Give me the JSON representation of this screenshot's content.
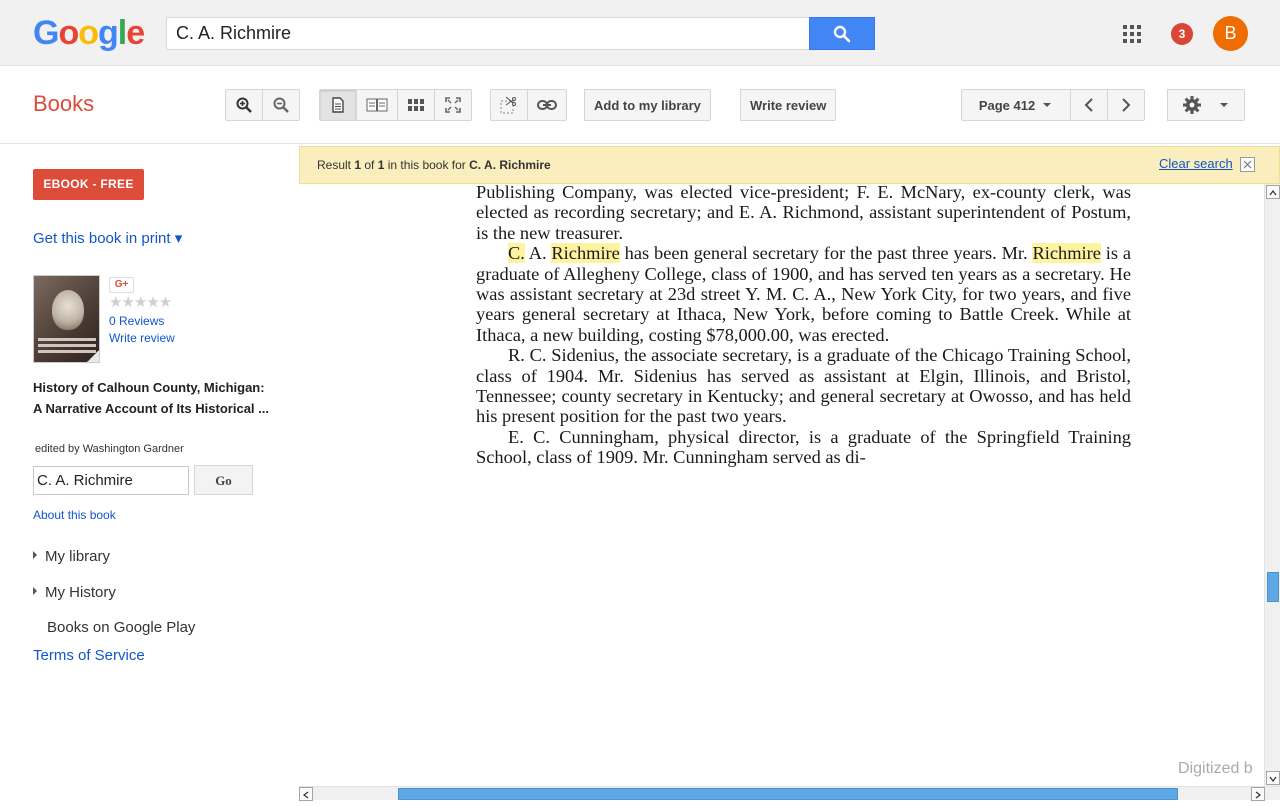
{
  "header": {
    "logo": {
      "letters": [
        "G",
        "o",
        "o",
        "g",
        "l",
        "e"
      ],
      "colors": [
        "#4285f4",
        "#ea4335",
        "#fbbc05",
        "#4285f4",
        "#34a853",
        "#ea4335"
      ]
    },
    "search": {
      "value": "C. A. Richmire",
      "button_icon": "search-icon"
    },
    "notifications": "3",
    "avatar_letter": "B"
  },
  "toolbar": {
    "section_title": "Books",
    "add_to_library": "Add to my library",
    "write_review": "Write review",
    "page_label": "Page 412"
  },
  "sidebar": {
    "ebook_button": "EBOOK - FREE",
    "get_print": "Get this book in print ▾",
    "gplus": "G+",
    "stars": "★★★★★",
    "reviews": "0 Reviews",
    "write_review": "Write review",
    "book_title": "History of Calhoun County, Michigan: A Narrative Account of Its Historical ...",
    "editor": "edited by Washington Gardner",
    "search_value": "C. A. Richmire",
    "go_button": "Go",
    "about": "About this book",
    "my_library": "My library",
    "my_history": "My History",
    "google_play": "Books on Google Play",
    "terms": "Terms of Service"
  },
  "banner": {
    "pre": "Result ",
    "index": "1",
    "mid1": " of ",
    "total": "1",
    "mid2": " in this book for ",
    "query": "C. A. Richmire",
    "clear": "Clear search"
  },
  "page": {
    "lines": [
      "Publishing Company, was elected vice-president; F. E. McNary, ex-county clerk, was elected as recording secretary; and E. A. Richmond, assistant superintendent of Postum, is the new treasurer."
    ],
    "p2_hl1": "C.",
    "p2_a": " A. ",
    "p2_hl2": "Richmire",
    "p2_b": " has been general secretary for the past three years. Mr. ",
    "p2_hl3": "Richmire",
    "p2_c": " is a graduate of Allegheny College, class of 1900, and has served ten years as a secretary. He was assistant secretary at 23d street Y. M. C. A., New York City, for two years, and five years general secretary at Ithaca, New York, before coming to Battle Creek. While at Ithaca, a new building, costing $78,000.00, was erected.",
    "p3": "R. C. Sidenius, the associate secretary, is a graduate of the Chicago Training School, class of 1904. Mr. Sidenius has served as assistant at Elgin, Illinois, and Bristol, Tennessee; county secretary in Kentucky; and general secretary at Owosso, and has held his present position for the past two years.",
    "p4": "E. C. Cunningham, physical director, is a graduate of the Springfield Training School, class of 1909. Mr. Cunningham served as di-",
    "digitized": "Digitized b"
  }
}
